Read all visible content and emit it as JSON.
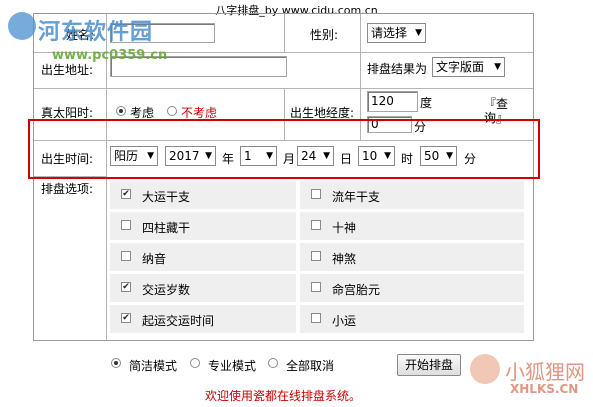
{
  "title": "八字排盘_by www.cidu.com.cn",
  "watermark": {
    "site_name": "河东软件园",
    "site_url": "www.pc0359.cn",
    "brand_cn": "小狐狸网",
    "brand_en": "XHLKS.CN"
  },
  "form": {
    "name_label": "姓名:",
    "gender_label": "性别:",
    "gender_value": "请选择",
    "birthplace_label": "出生地址:",
    "result_label": "排盘结果为",
    "result_value": "文字版面",
    "solar_label": "真太阳时:",
    "solar_consider": "考虑",
    "solar_not_consider": "不考虑",
    "longitude_label": "出生地经度:",
    "longitude_deg": "120",
    "deg_unit": "度",
    "longitude_min": "0",
    "min_unit": "分",
    "lookup_link": "『查询』",
    "birth_time_label": "出生时间:",
    "calendar": "阳历",
    "year": "2017",
    "year_unit": "年",
    "month": "1",
    "month_unit": "月",
    "day": "24",
    "day_unit": "日",
    "hour": "10",
    "hour_unit": "时",
    "minute": "50",
    "minute_unit": "分",
    "options_label": "排盘选项:"
  },
  "options": [
    {
      "label": "大运干支",
      "checked": true
    },
    {
      "label": "流年干支",
      "checked": false
    },
    {
      "label": "四柱藏干",
      "checked": false
    },
    {
      "label": "十神",
      "checked": false
    },
    {
      "label": "纳音",
      "checked": false
    },
    {
      "label": "神煞",
      "checked": false
    },
    {
      "label": "交运岁数",
      "checked": true
    },
    {
      "label": "命宫胎元",
      "checked": false
    },
    {
      "label": "起运交运时间",
      "checked": true
    },
    {
      "label": "小运",
      "checked": false
    }
  ],
  "modes": [
    {
      "label": "简洁模式",
      "selected": true
    },
    {
      "label": "专业模式",
      "selected": false
    },
    {
      "label": "全部取消",
      "selected": false
    }
  ],
  "start_button": "开始排盘",
  "welcome": "欢迎使用瓷都在线排盘系统。",
  "colors": {
    "highlight": "#d40000",
    "welcome": "#cc0000",
    "option_bg": "#efefef"
  }
}
